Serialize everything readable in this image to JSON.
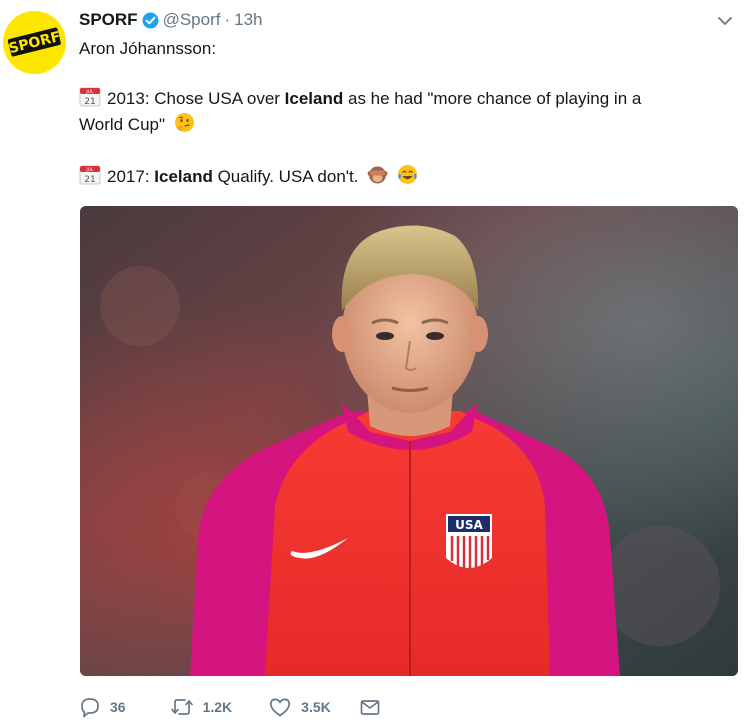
{
  "tweet": {
    "display_name": "SPORF",
    "handle": "@Sporf",
    "separator": "·",
    "time": "13h",
    "verified": true,
    "avatar_text": "SPORF",
    "lines": {
      "line1": "Aron Jóhannsson:",
      "line2_pre": "2013: Chose USA over ",
      "line2_bold": "Iceland",
      "line2_post": " as he had \"more chance of playing in a",
      "line3": "World Cup\"",
      "line4_bold": "Iceland",
      "line4_pre": "2017: ",
      "line4_post": " Qualify. USA don't."
    },
    "calendar_icon": {
      "month": "JUL",
      "day": "21"
    },
    "jersey_badge": "USA",
    "actions": {
      "reply_count": "36",
      "retweet_count": "1.2K",
      "like_count": "3.5K"
    }
  },
  "icons": {
    "calendar": "calendar-icon",
    "thinking": "thinking-face-icon",
    "laughing": "tears-of-joy-icon",
    "monkey": "see-no-evil-monkey-icon",
    "reply": "reply-icon",
    "retweet": "retweet-icon",
    "like": "heart-icon",
    "dm": "envelope-icon",
    "caret": "chevron-down-icon",
    "verified": "verified-badge-icon"
  },
  "colors": {
    "brand_yellow": "#ffe600",
    "verified_blue": "#1da1f2",
    "muted_text": "#657786",
    "jersey_red": "#f5322f",
    "jersey_magenta": "#d4157f"
  }
}
